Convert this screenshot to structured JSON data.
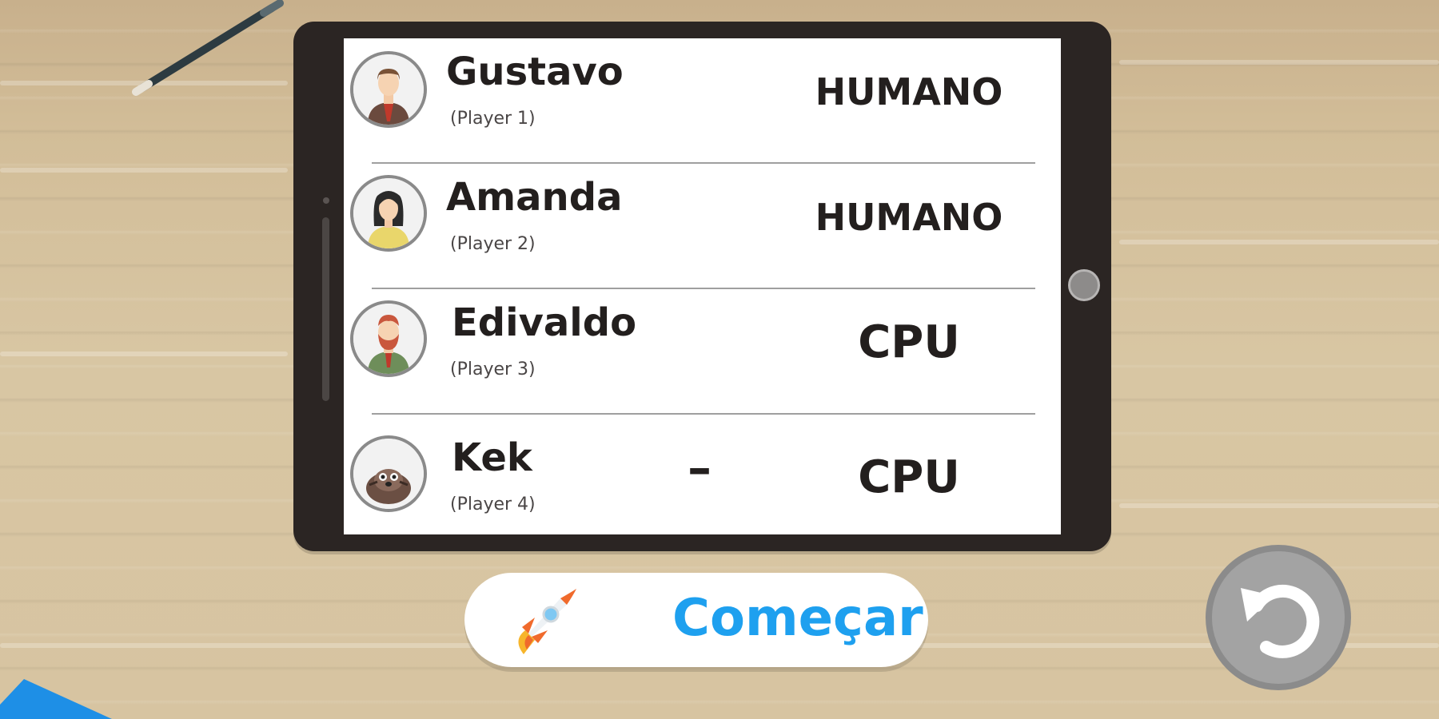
{
  "players": [
    {
      "name": "Gustavo",
      "slot": "(Player 1)",
      "type": "HUMANO",
      "avatar": "businessman-avatar-icon"
    },
    {
      "name": "Amanda",
      "slot": "(Player 2)",
      "type": "HUMANO",
      "avatar": "businesswoman-avatar-icon"
    },
    {
      "name": "Edivaldo",
      "slot": "(Player 3)",
      "type": "CPU",
      "avatar": "bearded-man-avatar-icon"
    },
    {
      "name": "Kek",
      "slot": "(Player 4)",
      "type": "CPU",
      "avatar": "sea-otter-avatar-icon",
      "extra": "–"
    }
  ],
  "start_button": {
    "label": "Começar",
    "icon": "rocket-icon"
  },
  "undo_button": {
    "icon": "undo-icon"
  },
  "colors": {
    "accent": "#1ea0ef",
    "tablet_frame": "#2b2523",
    "desk": "#d7c5a2"
  }
}
